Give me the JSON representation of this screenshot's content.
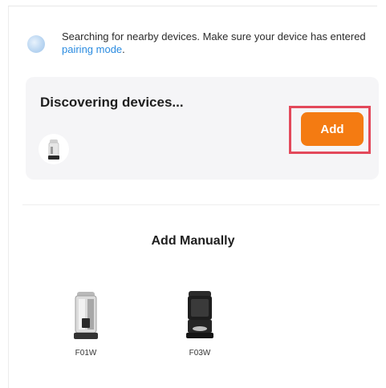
{
  "search_banner": {
    "text": "Searching for nearby devices. Make sure your device has entered ",
    "link": "pairing mode",
    "suffix": "."
  },
  "discovery": {
    "title": "Discovering devices...",
    "add_label": "Add",
    "accent_color": "#f47b12",
    "highlight_color": "#e3495b"
  },
  "manual": {
    "title": "Add Manually",
    "products": [
      {
        "label": "F01W",
        "icon": "silver-pet-feeder-icon"
      },
      {
        "label": "F03W",
        "icon": "black-pet-feeder-icon"
      }
    ]
  }
}
